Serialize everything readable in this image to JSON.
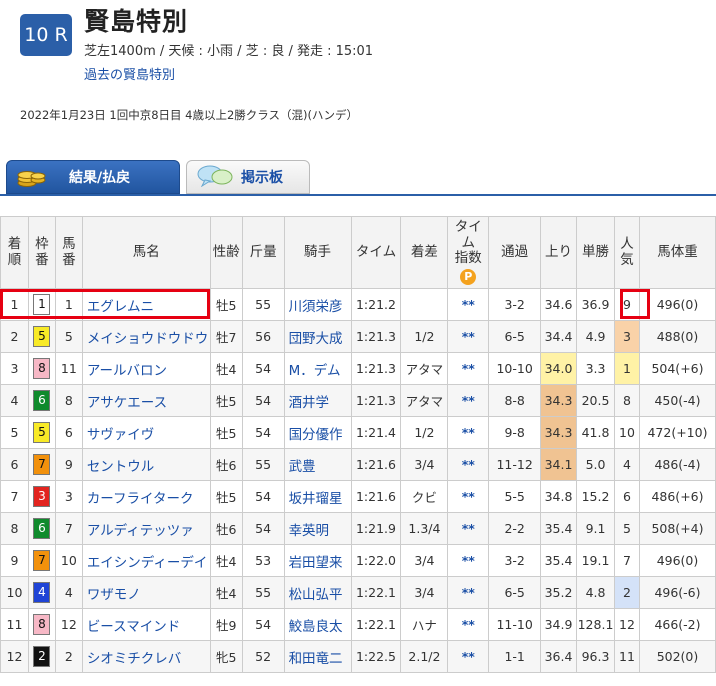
{
  "race": {
    "number": "10 R",
    "title": "賢島特別",
    "conditions": "芝左1400m / 天候 : 小雨 / 芝 : 良 / 発走 : 15:01",
    "past_link": "過去の賢島特別",
    "info": "2022年1月23日 1回中京8日目 4歳以上2勝クラス（混)(ハンデ）"
  },
  "tabs": {
    "result": "結果/払戻",
    "board": "掲示板"
  },
  "headers": {
    "rank": [
      "着",
      "順"
    ],
    "waku": [
      "枠",
      "番"
    ],
    "umaban": [
      "馬",
      "番"
    ],
    "name": "馬名",
    "sexage": "性齢",
    "weight": "斤量",
    "jockey": "騎手",
    "time": "タイム",
    "margin": "着差",
    "index": [
      "タイム",
      "指数"
    ],
    "index_badge": "P",
    "passing": "通過",
    "last3f": "上り",
    "odds": "単勝",
    "pop": [
      "人",
      "気"
    ],
    "body": "馬体重"
  },
  "rows": [
    {
      "rank": "1",
      "waku": "1",
      "umaban": "1",
      "name": "エグレムニ",
      "sexage": "牡5",
      "weight": "55",
      "jockey": "川須栄彦",
      "time": "1:21.2",
      "margin": "",
      "index": "**",
      "passing": "3-2",
      "last3f": "34.6",
      "odds": "36.9",
      "pop": "9",
      "body": "496(0)"
    },
    {
      "rank": "2",
      "waku": "5",
      "umaban": "5",
      "name": "メイショウドウドウ",
      "sexage": "牡7",
      "weight": "56",
      "jockey": "団野大成",
      "time": "1:21.3",
      "margin": "1/2",
      "index": "**",
      "passing": "6-5",
      "last3f": "34.4",
      "odds": "4.9",
      "pop": "3",
      "body": "488(0)"
    },
    {
      "rank": "3",
      "waku": "8",
      "umaban": "11",
      "name": "アールバロン",
      "sexage": "牡4",
      "weight": "54",
      "jockey": "M．デム",
      "time": "1:21.3",
      "margin": "アタマ",
      "index": "**",
      "passing": "10-10",
      "last3f": "34.0",
      "odds": "3.3",
      "pop": "1",
      "body": "504(+6)"
    },
    {
      "rank": "4",
      "waku": "6",
      "umaban": "8",
      "name": "アサケエース",
      "sexage": "牡5",
      "weight": "54",
      "jockey": "酒井学",
      "time": "1:21.3",
      "margin": "アタマ",
      "index": "**",
      "passing": "8-8",
      "last3f": "34.3",
      "odds": "20.5",
      "pop": "8",
      "body": "450(-4)"
    },
    {
      "rank": "5",
      "waku": "5",
      "umaban": "6",
      "name": "サヴァイヴ",
      "sexage": "牡5",
      "weight": "54",
      "jockey": "国分優作",
      "time": "1:21.4",
      "margin": "1/2",
      "index": "**",
      "passing": "9-8",
      "last3f": "34.3",
      "odds": "41.8",
      "pop": "10",
      "body": "472(+10)"
    },
    {
      "rank": "6",
      "waku": "7",
      "umaban": "9",
      "name": "セントウル",
      "sexage": "牡6",
      "weight": "55",
      "jockey": "武豊",
      "time": "1:21.6",
      "margin": "3/4",
      "index": "**",
      "passing": "11-12",
      "last3f": "34.1",
      "odds": "5.0",
      "pop": "4",
      "body": "486(-4)"
    },
    {
      "rank": "7",
      "waku": "3",
      "umaban": "3",
      "name": "カーフライターク",
      "sexage": "牡5",
      "weight": "54",
      "jockey": "坂井瑠星",
      "time": "1:21.6",
      "margin": "クビ",
      "index": "**",
      "passing": "5-5",
      "last3f": "34.8",
      "odds": "15.2",
      "pop": "6",
      "body": "486(+6)"
    },
    {
      "rank": "8",
      "waku": "6",
      "umaban": "7",
      "name": "アルディテッツァ",
      "sexage": "牡6",
      "weight": "54",
      "jockey": "幸英明",
      "time": "1:21.9",
      "margin": "1.3/4",
      "index": "**",
      "passing": "2-2",
      "last3f": "35.4",
      "odds": "9.1",
      "pop": "5",
      "body": "508(+4)"
    },
    {
      "rank": "9",
      "waku": "7",
      "umaban": "10",
      "name": "エイシンディーデイ",
      "sexage": "牡4",
      "weight": "53",
      "jockey": "岩田望来",
      "time": "1:22.0",
      "margin": "3/4",
      "index": "**",
      "passing": "3-2",
      "last3f": "35.4",
      "odds": "19.1",
      "pop": "7",
      "body": "496(0)"
    },
    {
      "rank": "10",
      "waku": "4",
      "umaban": "4",
      "name": "ワザモノ",
      "sexage": "牡4",
      "weight": "55",
      "jockey": "松山弘平",
      "time": "1:22.1",
      "margin": "3/4",
      "index": "**",
      "passing": "6-5",
      "last3f": "35.2",
      "odds": "4.8",
      "pop": "2",
      "body": "496(-6)"
    },
    {
      "rank": "11",
      "waku": "8",
      "umaban": "12",
      "name": "ビースマインド",
      "sexage": "牡9",
      "weight": "54",
      "jockey": "鮫島良太",
      "time": "1:22.1",
      "margin": "ハナ",
      "index": "**",
      "passing": "11-10",
      "last3f": "34.9",
      "odds": "128.1",
      "pop": "12",
      "body": "466(-2)"
    },
    {
      "rank": "12",
      "waku": "2",
      "umaban": "2",
      "name": "シオミチクレバ",
      "sexage": "牝5",
      "weight": "52",
      "jockey": "和田竜二",
      "time": "1:22.5",
      "margin": "2.1/2",
      "index": "**",
      "passing": "1-1",
      "last3f": "36.4",
      "odds": "96.3",
      "pop": "11",
      "body": "502(0)"
    }
  ],
  "colors": {
    "waku": {
      "1": "#ffffff",
      "2": "#111111",
      "3": "#e2241f",
      "4": "#1f44d6",
      "5": "#f8ea27",
      "6": "#0f8a2c",
      "7": "#f2910c",
      "8": "#f7b8c6"
    },
    "waku_text": {
      "1": "#111111",
      "2": "#ffffff",
      "3": "#ffffff",
      "4": "#ffffff",
      "5": "#111111",
      "6": "#ffffff",
      "7": "#111111",
      "8": "#111111"
    },
    "highlight_red": "#e60012",
    "link": "#1a4fa6"
  },
  "last3f_rank": {
    "1": "yel",
    "2": "ora",
    "3": "ora",
    "4": "blu"
  },
  "pop_rank": {
    "1": "yel",
    "2": "blu",
    "3": "oya"
  }
}
